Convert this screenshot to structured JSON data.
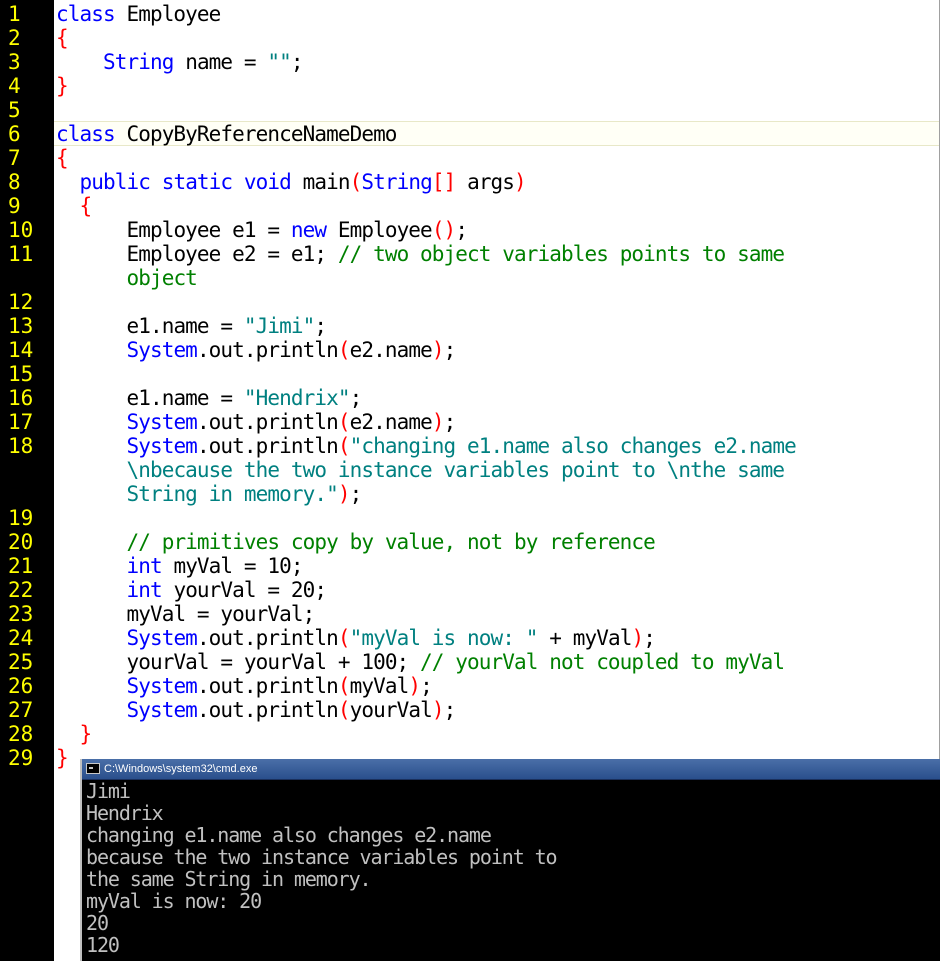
{
  "console": {
    "title": "C:\\Windows\\system32\\cmd.exe",
    "output": [
      "Jimi",
      "Hendrix",
      "changing e1.name also changes e2.name",
      "because the two instance variables point to",
      "the same String in memory.",
      "myVal is now: 20",
      "20",
      "120"
    ]
  },
  "editor": {
    "line_numbers": [
      "1",
      "2",
      "3",
      "4",
      "5",
      "6",
      "7",
      "8",
      "9",
      "10",
      "11",
      "12",
      "13",
      "14",
      "15",
      "16",
      "17",
      "18",
      "19",
      "20",
      "21",
      "22",
      "23",
      "24",
      "25",
      "26",
      "27",
      "28",
      "29"
    ],
    "code": {
      "l1_kw": "class",
      "l1_rest": " Employee",
      "l2_br": "{",
      "l3_indent": "    ",
      "l3_type": "String",
      "l3_rest": " name = ",
      "l3_str": "\"\"",
      "l3_end": ";",
      "l4_br": "}",
      "l6_kw": "class",
      "l6_rest": " CopyByReferenceNameDemo",
      "l7_br": "{",
      "l8_indent": "  ",
      "l8_kw": "public static void",
      "l8_rest": " main",
      "l8_p1": "(",
      "l8_type": "String",
      "l8_arr": "[]",
      "l8_args": " args",
      "l8_p2": ")",
      "l9_indent": "  ",
      "l9_br": "{",
      "l10_indent": "      ",
      "l10_a": "Employee e1 = ",
      "l10_kw": "new",
      "l10_b": " Employee",
      "l10_br": "()",
      "l10_end": ";",
      "l11_indent": "      ",
      "l11_a": "Employee e2 = e1; ",
      "l11_cm": "// two object variables points to same",
      "l11b_indent": "      ",
      "l11b_cm": "object",
      "l13_indent": "      ",
      "l13_a": "e1.name = ",
      "l13_str": "\"Jimi\"",
      "l13_end": ";",
      "l14_indent": "      ",
      "l14_sys": "System",
      "l14_a": ".out.println",
      "l14_p1": "(",
      "l14_b": "e2.name",
      "l14_p2": ")",
      "l14_end": ";",
      "l16_indent": "      ",
      "l16_a": "e1.name = ",
      "l16_str": "\"Hendrix\"",
      "l16_end": ";",
      "l17_indent": "      ",
      "l17_sys": "System",
      "l17_a": ".out.println",
      "l17_p1": "(",
      "l17_b": "e2.name",
      "l17_p2": ")",
      "l17_end": ";",
      "l18_indent": "      ",
      "l18_sys": "System",
      "l18_a": ".out.println",
      "l18_p1": "(",
      "l18_str": "\"changing e1.name also changes e2.name",
      "l18b_indent": "      ",
      "l18b_str": "\\nbecause the two instance variables point to \\nthe same",
      "l18c_indent": "      ",
      "l18c_str": "String in memory.\"",
      "l18c_p2": ")",
      "l18c_end": ";",
      "l20_indent": "      ",
      "l20_cm": "// primitives copy by value, not by reference",
      "l21_indent": "      ",
      "l21_kw": "int",
      "l21_rest": " myVal = 10;",
      "l22_indent": "      ",
      "l22_kw": "int",
      "l22_rest": " yourVal = 20;",
      "l23_indent": "      ",
      "l23_rest": "myVal = yourVal;",
      "l24_indent": "      ",
      "l24_sys": "System",
      "l24_a": ".out.println",
      "l24_p1": "(",
      "l24_str": "\"myVal is now: \"",
      "l24_b": " + myVal",
      "l24_p2": ")",
      "l24_end": ";",
      "l25_indent": "      ",
      "l25_a": "yourVal = yourVal + 100; ",
      "l25_cm": "// yourVal not coupled to myVal",
      "l26_indent": "      ",
      "l26_sys": "System",
      "l26_a": ".out.println",
      "l26_p1": "(",
      "l26_b": "myVal",
      "l26_p2": ")",
      "l26_end": ";",
      "l27_indent": "      ",
      "l27_sys": "System",
      "l27_a": ".out.println",
      "l27_p1": "(",
      "l27_b": "yourVal",
      "l27_p2": ")",
      "l27_end": ";",
      "l28_indent": "  ",
      "l28_br": "}",
      "l29_br": "}"
    }
  },
  "colors": {
    "gutter_bg": "#000000",
    "line_number": "#ffff00",
    "keyword": "#0000ff",
    "brace": "#ff0000",
    "string": "#008080",
    "comment": "#008000",
    "console_bg": "#000000",
    "console_text": "#c0c0c0"
  }
}
